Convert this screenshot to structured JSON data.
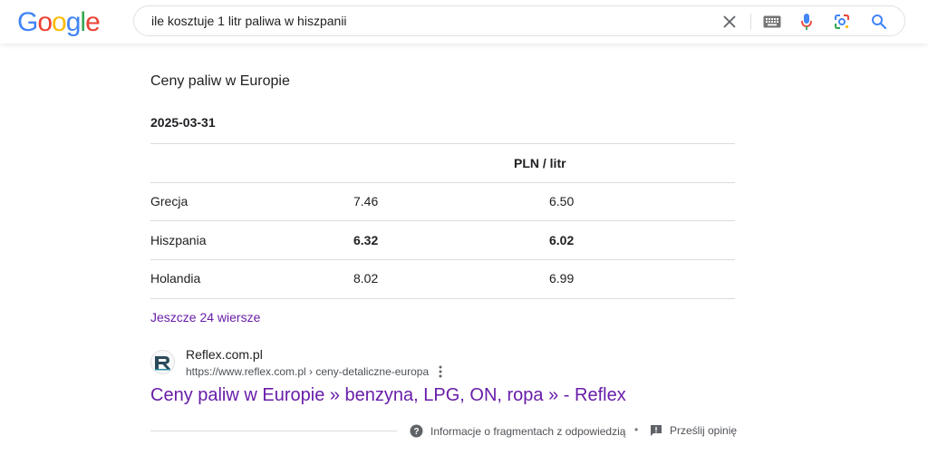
{
  "header": {
    "logo_letters": [
      "G",
      "o",
      "o",
      "g",
      "l",
      "e"
    ],
    "logo_colors": [
      "#4285F4",
      "#EA4335",
      "#FBBC05",
      "#4285F4",
      "#34A853",
      "#EA4335"
    ],
    "query": "ile kosztuje 1 litr paliwa w hiszpanii"
  },
  "snippet": {
    "title": "Ceny paliw w Europie",
    "date": "2025-03-31",
    "column_header": "PLN / litr",
    "rows": [
      {
        "country": "Grecja",
        "col1": "7.46",
        "col2": "6.50"
      },
      {
        "country": "Hiszpania",
        "col1": "6.32",
        "col2": "6.02"
      },
      {
        "country": "Holandia",
        "col1": "8.02",
        "col2": "6.99"
      }
    ],
    "more_rows": "Jeszcze 24 wiersze"
  },
  "source": {
    "name": "Reflex.com.pl",
    "url": "https://www.reflex.com.pl › ceny-detaliczne-europa",
    "title": "Ceny paliw w Europie » benzyna, LPG, ON, ropa » - Reflex"
  },
  "footer": {
    "about": "Informacje o fragmentach z odpowiedzią",
    "separator": "•",
    "feedback": "Prześlij opinię"
  },
  "colors": {
    "link_visited": "#681da8",
    "mic_blue": "#4285F4",
    "mic_red": "#EA4335"
  }
}
